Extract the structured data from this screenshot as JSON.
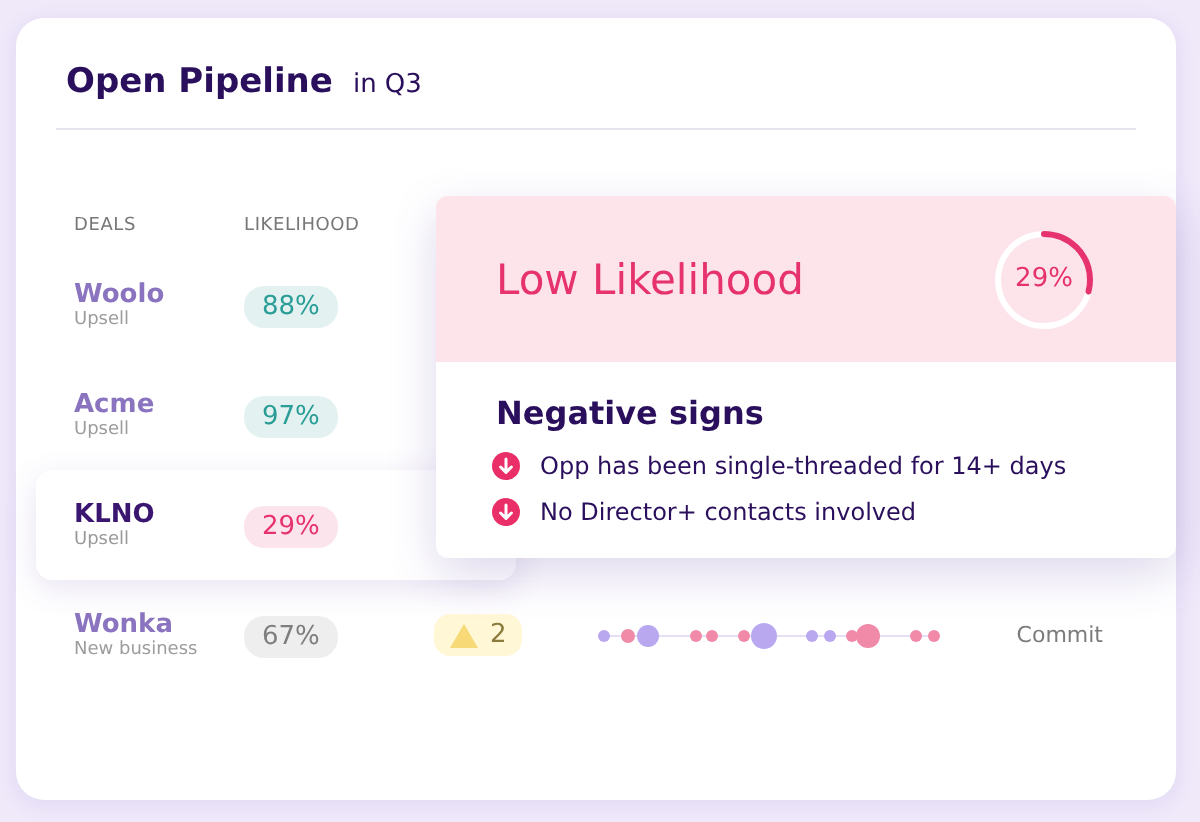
{
  "title": "Open Pipeline",
  "subtitle": "in Q3",
  "columns": [
    "DEALS",
    "LIKELIHOOD"
  ],
  "rows": [
    {
      "deal": "Woolo",
      "type": "Upsell",
      "likelihood": "88%",
      "color": "#2a9d96",
      "selected": false
    },
    {
      "deal": "Acme",
      "type": "Upsell",
      "likelihood": "97%",
      "color": "#2a9d96",
      "selected": false
    },
    {
      "deal": "KLNO",
      "type": "Upsell",
      "likelihood": "29%",
      "color": "#e6326e",
      "selected": true
    },
    {
      "deal": "Wonka",
      "type": "New business",
      "likelihood": "67%",
      "color": "#7e7e7e",
      "selected": false,
      "warnings": "2",
      "stage": "Commit"
    }
  ],
  "popup": {
    "title": "Low Likelihood",
    "score": "29%",
    "level": 0.29,
    "section": "Negative signs",
    "signs": [
      "Opp has been single-threaded for 14+ days",
      "No Director+ contacts involved"
    ]
  }
}
